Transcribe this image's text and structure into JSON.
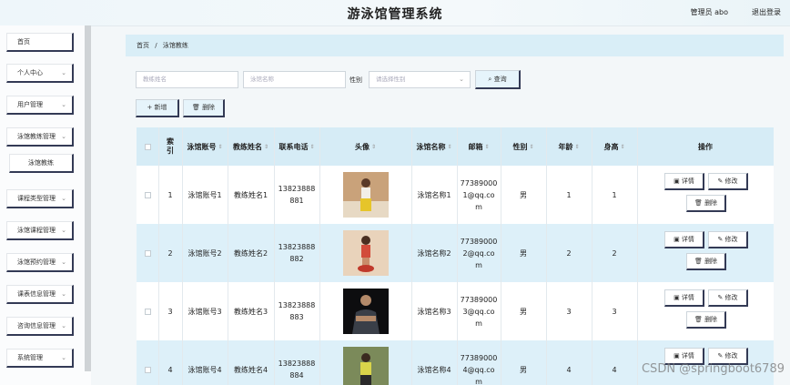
{
  "header": {
    "title": "游泳馆管理系统",
    "admin": "管理员 abo",
    "logout": "退出登录"
  },
  "sidebar": {
    "items": [
      {
        "label": "首页",
        "chevron": false
      },
      {
        "label": "个人中心",
        "chevron": true
      },
      {
        "label": "用户管理",
        "chevron": true
      },
      {
        "label": "泳馆教练管理",
        "chevron": true
      },
      {
        "label": "泳馆教练",
        "chevron": false,
        "sub": true
      },
      {
        "label": "课程类型管理",
        "chevron": true
      },
      {
        "label": "泳馆课程管理",
        "chevron": true
      },
      {
        "label": "泳馆预约管理",
        "chevron": true
      },
      {
        "label": "课表信息管理",
        "chevron": true
      },
      {
        "label": "咨询信息管理",
        "chevron": true
      },
      {
        "label": "系统管理",
        "chevron": true
      }
    ]
  },
  "breadcrumb": {
    "home": "首页",
    "sep": "/",
    "current": "泳馆教练"
  },
  "search": {
    "name_placeholder": "教练姓名",
    "venue_placeholder": "泳馆名称",
    "gender_label": "性别",
    "gender_placeholder": "请选择性别",
    "search_label": "查询"
  },
  "actions": {
    "add": "新增",
    "delete": "删除"
  },
  "table": {
    "columns": [
      "索引",
      "泳馆账号",
      "教练姓名",
      "联系电话",
      "头像",
      "泳馆名称",
      "邮箱",
      "性别",
      "年龄",
      "身高",
      "操作"
    ],
    "ops": {
      "detail": "详情",
      "edit": "修改",
      "delete": "删除"
    },
    "rows": [
      {
        "index": "1",
        "account": "泳馆账号1",
        "coach": "教练姓名1",
        "phone1": "13823888",
        "phone2": "881",
        "venue": "泳馆名称1",
        "email1": "77389000",
        "email2": "1@qq.co",
        "email3": "m",
        "gender": "男",
        "age": "1",
        "height": "1"
      },
      {
        "index": "2",
        "account": "泳馆账号2",
        "coach": "教练姓名2",
        "phone1": "13823888",
        "phone2": "882",
        "venue": "泳馆名称2",
        "email1": "77389000",
        "email2": "2@qq.co",
        "email3": "m",
        "gender": "男",
        "age": "2",
        "height": "2"
      },
      {
        "index": "3",
        "account": "泳馆账号3",
        "coach": "教练姓名3",
        "phone1": "13823888",
        "phone2": "883",
        "venue": "泳馆名称3",
        "email1": "77389000",
        "email2": "3@qq.co",
        "email3": "m",
        "gender": "男",
        "age": "3",
        "height": "3"
      },
      {
        "index": "4",
        "account": "泳馆账号4",
        "coach": "教练姓名4",
        "phone1": "13823888",
        "phone2": "884",
        "venue": "泳馆名称4",
        "email1": "77389000",
        "email2": "4@qq.co",
        "email3": "m",
        "gender": "男",
        "age": "4",
        "height": "4"
      }
    ]
  },
  "watermark": "CSDN @springboot6789",
  "colors": {
    "accent": "#333a55",
    "header_bg": "#d6ecf6",
    "row_alt": "#ddf0f9"
  }
}
